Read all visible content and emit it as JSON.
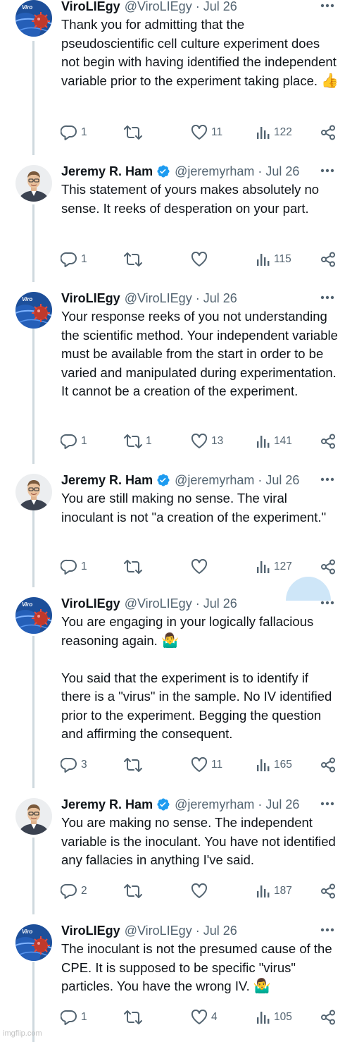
{
  "watermark": "imgflip.com",
  "tweets": [
    {
      "name": "ViroLIEgy",
      "handle": "@ViroLIEgy",
      "date": "Jul 26",
      "verified": false,
      "avatar_label": "Viro",
      "text": [
        "Thank you for admitting that the pseudoscientific cell culture experiment does not begin with having identified the independent variable prior to the experiment taking place."
      ],
      "emoji": "👍",
      "replies": "1",
      "reposts": "",
      "likes": "11",
      "views": "122"
    },
    {
      "name": "Jeremy R. Ham",
      "handle": "@jeremyrham",
      "date": "Jul 26",
      "verified": true,
      "text": [
        "This statement of yours makes absolutely no sense. It reeks of desperation on your part."
      ],
      "replies": "1",
      "reposts": "",
      "likes": "",
      "views": "115"
    },
    {
      "name": "ViroLIEgy",
      "handle": "@ViroLIEgy",
      "date": "Jul 26",
      "verified": false,
      "avatar_label": "Viro",
      "text": [
        "Your response reeks of you not understanding the scientific method. Your independent variable must be available from the start in order to be varied and manipulated during experimentation. It cannot be a creation of the experiment."
      ],
      "replies": "1",
      "reposts": "1",
      "likes": "13",
      "views": "141"
    },
    {
      "name": "Jeremy R. Ham",
      "handle": "@jeremyrham",
      "date": "Jul 26",
      "verified": true,
      "text": [
        "You are still making no sense. The viral inoculant is not \"a creation of the experiment.\""
      ],
      "replies": "1",
      "reposts": "",
      "likes": "",
      "views": "127"
    },
    {
      "name": "ViroLIEgy",
      "handle": "@ViroLIEgy",
      "date": "Jul 26",
      "verified": false,
      "avatar_label": "Viro",
      "text": [
        "You are engaging in your logically fallacious reasoning again.",
        "You said that the experiment is to identify if there is a \"virus\" in the sample. No IV identified prior to the experiment. Begging the question and affirming the consequent."
      ],
      "emoji": "🤷‍♂️",
      "replies": "3",
      "reposts": "",
      "likes": "11",
      "views": "165"
    },
    {
      "name": "Jeremy R. Ham",
      "handle": "@jeremyrham",
      "date": "Jul 26",
      "verified": true,
      "text": [
        "You are making no sense. The independent variable is the inoculant. You have not identified any fallacies in anything I've said."
      ],
      "replies": "2",
      "reposts": "",
      "likes": "",
      "views": "187"
    },
    {
      "name": "ViroLIEgy",
      "handle": "@ViroLIEgy",
      "date": "Jul 26",
      "verified": false,
      "avatar_label": "Viro",
      "text": [
        "The inoculant is not the presumed cause of the CPE. It is supposed to be specific \"virus\" particles. You have the wrong IV."
      ],
      "emoji": "🤷‍♂️",
      "replies": "1",
      "reposts": "",
      "likes": "4",
      "views": "105"
    }
  ]
}
